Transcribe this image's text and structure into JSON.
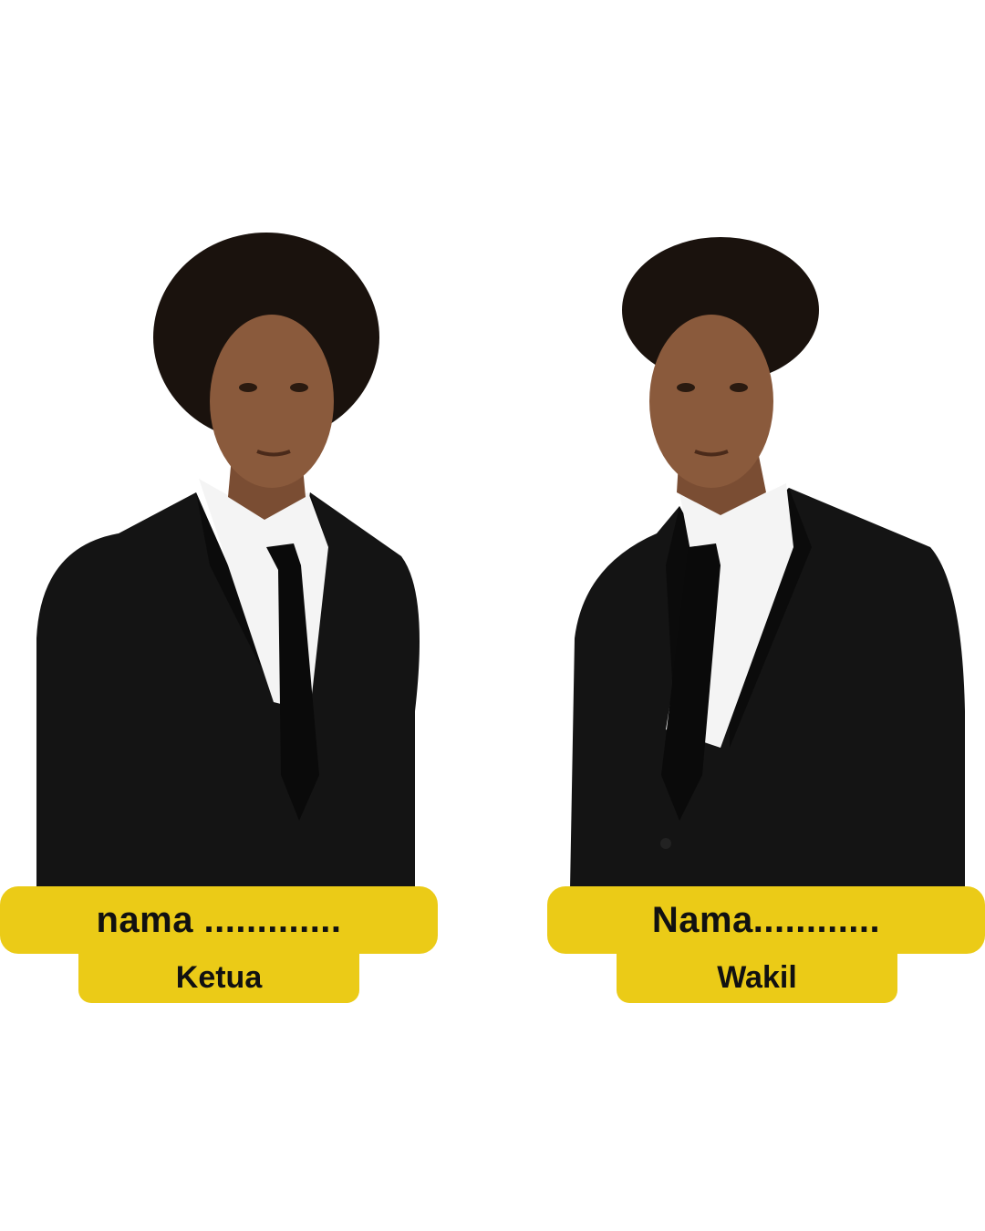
{
  "colors": {
    "background": "#ffffff",
    "plate": "#EBCB17",
    "text": "#111111",
    "suit": "#141414",
    "hair": "#1a120d",
    "skin": "#8a5a3c",
    "shirt": "#f4f4f4"
  },
  "people": [
    {
      "name_label": "nama .............",
      "role_label": "Ketua"
    },
    {
      "name_label": "Nama............",
      "role_label": "Wakil"
    }
  ]
}
